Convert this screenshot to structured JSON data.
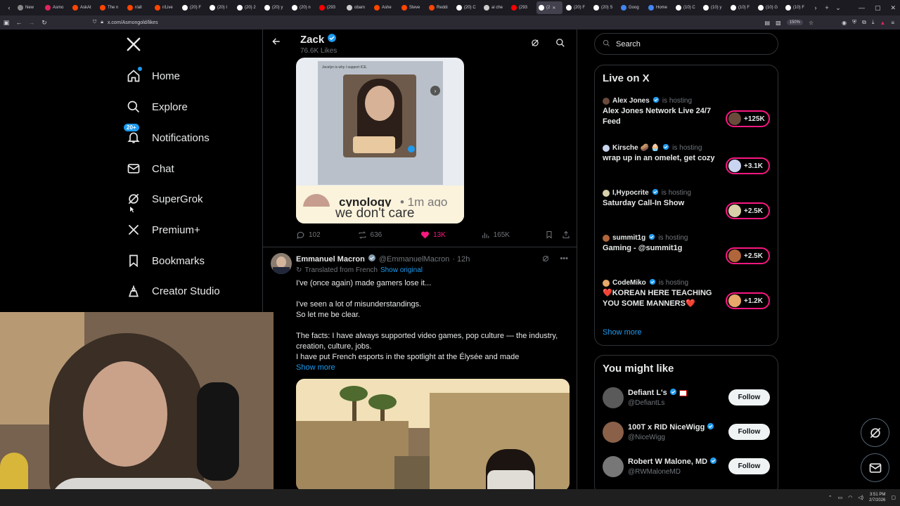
{
  "browser": {
    "tabs": [
      {
        "label": "New",
        "fav": "#888888"
      },
      {
        "label": "Asmo",
        "fav": "#e0245e"
      },
      {
        "label": "AskAt",
        "fav": "#ff4500"
      },
      {
        "label": "The n",
        "fav": "#ff4500"
      },
      {
        "label": "r/all",
        "fav": "#ff4500"
      },
      {
        "label": "r/Live",
        "fav": "#ff4500"
      },
      {
        "label": "(20) F",
        "fav": "#ffffff"
      },
      {
        "label": "(20) I",
        "fav": "#ffffff"
      },
      {
        "label": "(20) 2",
        "fav": "#ffffff"
      },
      {
        "label": "(20) y",
        "fav": "#ffffff"
      },
      {
        "label": "(20) n",
        "fav": "#ffffff"
      },
      {
        "label": "(293",
        "fav": "#ff0000"
      },
      {
        "label": "obam",
        "fav": "#cccccc"
      },
      {
        "label": "Ashe",
        "fav": "#ff4500"
      },
      {
        "label": "Steve",
        "fav": "#ff4500"
      },
      {
        "label": "Reddi",
        "fav": "#ff4500"
      },
      {
        "label": "(20) C",
        "fav": "#ffffff"
      },
      {
        "label": "ai che",
        "fav": "#cccccc"
      },
      {
        "label": "(293",
        "fav": "#ff0000"
      },
      {
        "label": "(2",
        "fav": "#ffffff"
      },
      {
        "label": "(20) F",
        "fav": "#ffffff"
      },
      {
        "label": "(20) S",
        "fav": "#ffffff"
      },
      {
        "label": "Goog",
        "fav": "#4285f4"
      },
      {
        "label": "Home",
        "fav": "#4285f4"
      },
      {
        "label": "(10) C",
        "fav": "#ffffff"
      },
      {
        "label": "(10) y",
        "fav": "#ffffff"
      },
      {
        "label": "(10) F",
        "fav": "#ffffff"
      },
      {
        "label": "(10) G",
        "fav": "#ffffff"
      },
      {
        "label": "(10) F",
        "fav": "#ffffff"
      }
    ],
    "url": "x.com/Asmongold/likes",
    "zoom": "150%"
  },
  "nav": {
    "items": [
      {
        "label": "Home",
        "icon": "home-icon"
      },
      {
        "label": "Explore",
        "icon": "search-icon"
      },
      {
        "label": "Notifications",
        "icon": "bell-icon",
        "badge": "20+"
      },
      {
        "label": "Chat",
        "icon": "mail-icon"
      },
      {
        "label": "SuperGrok",
        "icon": "grok-icon"
      },
      {
        "label": "Premium+",
        "icon": "x-icon"
      },
      {
        "label": "Bookmarks",
        "icon": "bookmark-icon"
      },
      {
        "label": "Creator Studio",
        "icon": "creator-icon"
      }
    ]
  },
  "header": {
    "name": "Zack",
    "likes": "76.6K Likes"
  },
  "first_post": {
    "caption": "Jocelyn is why I support ICE.",
    "comment_user": "cynology",
    "comment_time": "• 1m ago",
    "comment_text": "we don't care",
    "replies": "102",
    "reposts": "636",
    "likes": "13K",
    "views": "165K"
  },
  "tweet": {
    "name": "Emmanuel Macron",
    "handle": "@EmmanuelMacron",
    "time": "· 12h",
    "translated": "Translated from French",
    "show_original": "Show original",
    "lines": [
      "I've (once again) made gamers lose it...",
      "",
      "I've seen a lot of misunderstandings.",
      "So let me be clear.",
      "",
      "The facts: I have always supported video games, pop culture — the industry, creation, culture, jobs.",
      "I have put French esports in the spotlight at the Élysée and made"
    ],
    "show_more": "Show more"
  },
  "right": {
    "search_placeholder": "Search",
    "live_title": "Live on X",
    "hosting_label": "is hosting",
    "live": [
      {
        "host": "Alex Jones",
        "title": "Alex Jones Network Live 24/7 Feed",
        "count": "+125K",
        "pill_color": "#6a4a3a"
      },
      {
        "host": "Kirsche 🥔 🧁",
        "title": "wrap up in an omelet, get cozy",
        "count": "+3.1K",
        "pill_color": "#c9d4f0"
      },
      {
        "host": "I,Hypocrite",
        "title": "Saturday Call-In Show",
        "count": "+2.5K",
        "pill_color": "#d8d0a8"
      },
      {
        "host": "summit1g",
        "title": "Gaming - @summit1g",
        "count": "+2.5K",
        "pill_color": "#b0663a"
      },
      {
        "host": "CodeMiko",
        "title": "❤️KOREAN HERE TEACHING YOU SOME MANNERS❤️",
        "count": "+1.2K",
        "pill_color": "#e8a86a"
      }
    ],
    "live_show_more": "Show more",
    "wtf_title": "You might like",
    "follow": [
      {
        "name": "Defiant L's",
        "handle": "@DefiantLs"
      },
      {
        "name": "100T x RID NiceWigg",
        "handle": "@NiceWigg"
      },
      {
        "name": "Robert W Malone, MD",
        "handle": "@RWMaloneMD"
      }
    ],
    "follow_label": "Follow"
  },
  "taskbar": {
    "time": "3:51 PM",
    "date": "2/7/2026"
  },
  "colors": {
    "accent": "#1d9bf0",
    "live": "#f91880",
    "like": "#f91880"
  }
}
